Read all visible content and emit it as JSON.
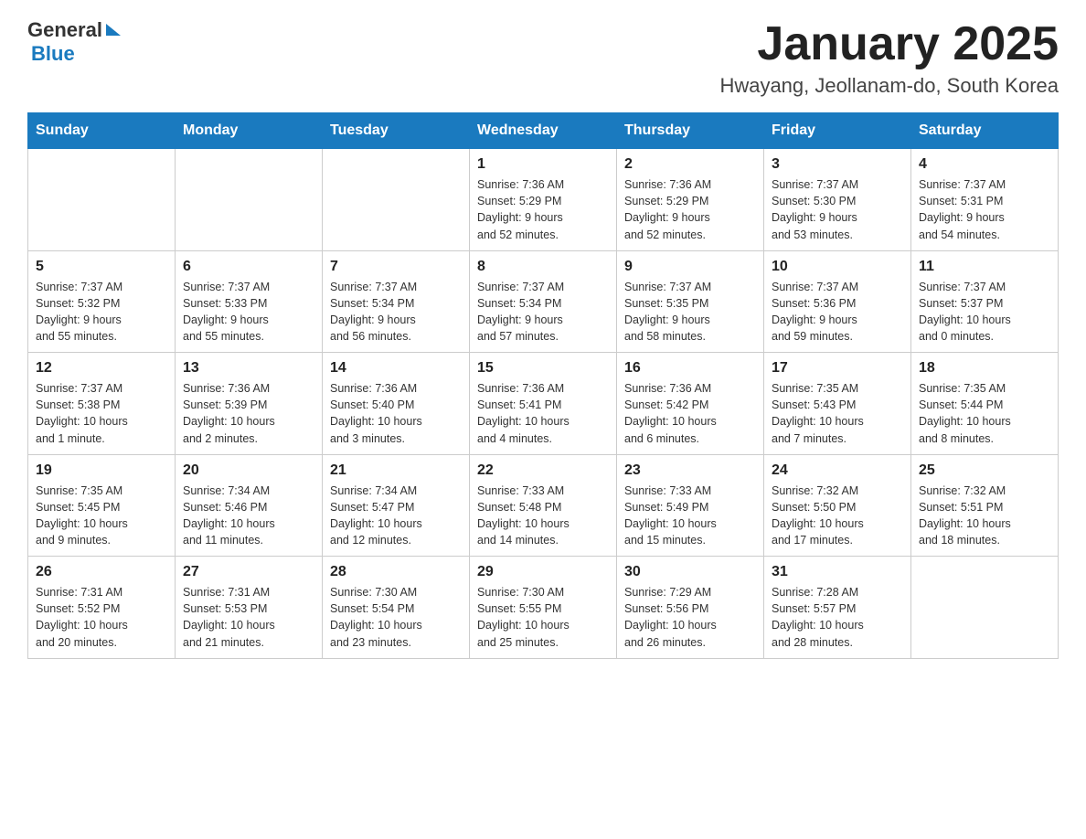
{
  "header": {
    "logo_general": "General",
    "logo_blue": "Blue",
    "title": "January 2025",
    "subtitle": "Hwayang, Jeollanam-do, South Korea"
  },
  "days": [
    "Sunday",
    "Monday",
    "Tuesday",
    "Wednesday",
    "Thursday",
    "Friday",
    "Saturday"
  ],
  "weeks": [
    [
      {
        "date": "",
        "info": ""
      },
      {
        "date": "",
        "info": ""
      },
      {
        "date": "",
        "info": ""
      },
      {
        "date": "1",
        "info": "Sunrise: 7:36 AM\nSunset: 5:29 PM\nDaylight: 9 hours\nand 52 minutes."
      },
      {
        "date": "2",
        "info": "Sunrise: 7:36 AM\nSunset: 5:29 PM\nDaylight: 9 hours\nand 52 minutes."
      },
      {
        "date": "3",
        "info": "Sunrise: 7:37 AM\nSunset: 5:30 PM\nDaylight: 9 hours\nand 53 minutes."
      },
      {
        "date": "4",
        "info": "Sunrise: 7:37 AM\nSunset: 5:31 PM\nDaylight: 9 hours\nand 54 minutes."
      }
    ],
    [
      {
        "date": "5",
        "info": "Sunrise: 7:37 AM\nSunset: 5:32 PM\nDaylight: 9 hours\nand 55 minutes."
      },
      {
        "date": "6",
        "info": "Sunrise: 7:37 AM\nSunset: 5:33 PM\nDaylight: 9 hours\nand 55 minutes."
      },
      {
        "date": "7",
        "info": "Sunrise: 7:37 AM\nSunset: 5:34 PM\nDaylight: 9 hours\nand 56 minutes."
      },
      {
        "date": "8",
        "info": "Sunrise: 7:37 AM\nSunset: 5:34 PM\nDaylight: 9 hours\nand 57 minutes."
      },
      {
        "date": "9",
        "info": "Sunrise: 7:37 AM\nSunset: 5:35 PM\nDaylight: 9 hours\nand 58 minutes."
      },
      {
        "date": "10",
        "info": "Sunrise: 7:37 AM\nSunset: 5:36 PM\nDaylight: 9 hours\nand 59 minutes."
      },
      {
        "date": "11",
        "info": "Sunrise: 7:37 AM\nSunset: 5:37 PM\nDaylight: 10 hours\nand 0 minutes."
      }
    ],
    [
      {
        "date": "12",
        "info": "Sunrise: 7:37 AM\nSunset: 5:38 PM\nDaylight: 10 hours\nand 1 minute."
      },
      {
        "date": "13",
        "info": "Sunrise: 7:36 AM\nSunset: 5:39 PM\nDaylight: 10 hours\nand 2 minutes."
      },
      {
        "date": "14",
        "info": "Sunrise: 7:36 AM\nSunset: 5:40 PM\nDaylight: 10 hours\nand 3 minutes."
      },
      {
        "date": "15",
        "info": "Sunrise: 7:36 AM\nSunset: 5:41 PM\nDaylight: 10 hours\nand 4 minutes."
      },
      {
        "date": "16",
        "info": "Sunrise: 7:36 AM\nSunset: 5:42 PM\nDaylight: 10 hours\nand 6 minutes."
      },
      {
        "date": "17",
        "info": "Sunrise: 7:35 AM\nSunset: 5:43 PM\nDaylight: 10 hours\nand 7 minutes."
      },
      {
        "date": "18",
        "info": "Sunrise: 7:35 AM\nSunset: 5:44 PM\nDaylight: 10 hours\nand 8 minutes."
      }
    ],
    [
      {
        "date": "19",
        "info": "Sunrise: 7:35 AM\nSunset: 5:45 PM\nDaylight: 10 hours\nand 9 minutes."
      },
      {
        "date": "20",
        "info": "Sunrise: 7:34 AM\nSunset: 5:46 PM\nDaylight: 10 hours\nand 11 minutes."
      },
      {
        "date": "21",
        "info": "Sunrise: 7:34 AM\nSunset: 5:47 PM\nDaylight: 10 hours\nand 12 minutes."
      },
      {
        "date": "22",
        "info": "Sunrise: 7:33 AM\nSunset: 5:48 PM\nDaylight: 10 hours\nand 14 minutes."
      },
      {
        "date": "23",
        "info": "Sunrise: 7:33 AM\nSunset: 5:49 PM\nDaylight: 10 hours\nand 15 minutes."
      },
      {
        "date": "24",
        "info": "Sunrise: 7:32 AM\nSunset: 5:50 PM\nDaylight: 10 hours\nand 17 minutes."
      },
      {
        "date": "25",
        "info": "Sunrise: 7:32 AM\nSunset: 5:51 PM\nDaylight: 10 hours\nand 18 minutes."
      }
    ],
    [
      {
        "date": "26",
        "info": "Sunrise: 7:31 AM\nSunset: 5:52 PM\nDaylight: 10 hours\nand 20 minutes."
      },
      {
        "date": "27",
        "info": "Sunrise: 7:31 AM\nSunset: 5:53 PM\nDaylight: 10 hours\nand 21 minutes."
      },
      {
        "date": "28",
        "info": "Sunrise: 7:30 AM\nSunset: 5:54 PM\nDaylight: 10 hours\nand 23 minutes."
      },
      {
        "date": "29",
        "info": "Sunrise: 7:30 AM\nSunset: 5:55 PM\nDaylight: 10 hours\nand 25 minutes."
      },
      {
        "date": "30",
        "info": "Sunrise: 7:29 AM\nSunset: 5:56 PM\nDaylight: 10 hours\nand 26 minutes."
      },
      {
        "date": "31",
        "info": "Sunrise: 7:28 AM\nSunset: 5:57 PM\nDaylight: 10 hours\nand 28 minutes."
      },
      {
        "date": "",
        "info": ""
      }
    ]
  ]
}
